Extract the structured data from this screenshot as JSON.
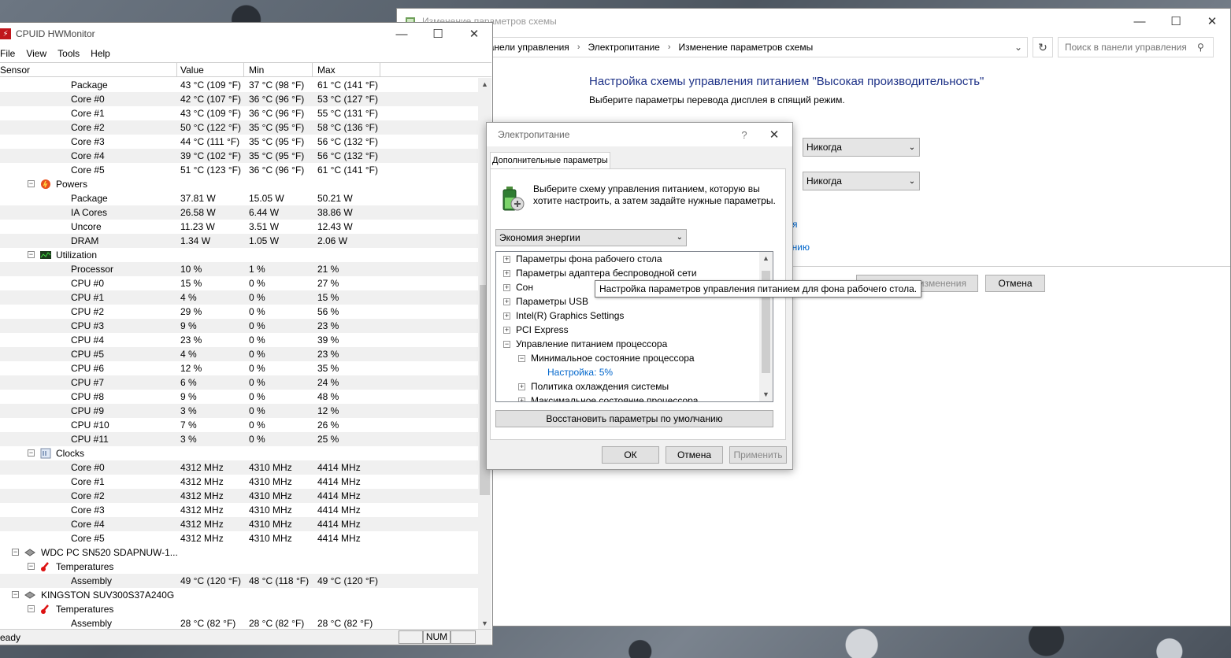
{
  "control_panel": {
    "title": "Изменение параметров схемы",
    "breadcrumb": [
      "Все элементы панели управления",
      "Электропитание",
      "Изменение параметров схемы"
    ],
    "search_placeholder": "Поиск в панели управления",
    "heading": "Настройка схемы управления питанием \"Высокая производительность\"",
    "subheading": "Выберите параметры перевода дисплея в спящий режим.",
    "select1": "Никогда",
    "select2": "Никогда",
    "link1_tail": "я",
    "link2_tail": "анию",
    "save_button_tail": "изменения",
    "cancel_button": "Отмена"
  },
  "hwmonitor": {
    "title": "CPUID HWMonitor",
    "menu": [
      "File",
      "View",
      "Tools",
      "Help"
    ],
    "columns": [
      "Sensor",
      "Value",
      "Min",
      "Max"
    ],
    "status": "eady",
    "num_indicator": "NUM",
    "rows": [
      {
        "level": 3,
        "name": "Package",
        "value": "43 °C  (109 °F)",
        "min": "37 °C  (98 °F)",
        "max": "61 °C  (141 °F)"
      },
      {
        "level": 3,
        "name": "Core #0",
        "value": "42 °C  (107 °F)",
        "min": "36 °C  (96 °F)",
        "max": "53 °C  (127 °F)"
      },
      {
        "level": 3,
        "name": "Core #1",
        "value": "43 °C  (109 °F)",
        "min": "36 °C  (96 °F)",
        "max": "55 °C  (131 °F)"
      },
      {
        "level": 3,
        "name": "Core #2",
        "value": "50 °C  (122 °F)",
        "min": "35 °C  (95 °F)",
        "max": "58 °C  (136 °F)"
      },
      {
        "level": 3,
        "name": "Core #3",
        "value": "44 °C  (111 °F)",
        "min": "35 °C  (95 °F)",
        "max": "56 °C  (132 °F)"
      },
      {
        "level": 3,
        "name": "Core #4",
        "value": "39 °C  (102 °F)",
        "min": "35 °C  (95 °F)",
        "max": "56 °C  (132 °F)"
      },
      {
        "level": 3,
        "name": "Core #5",
        "value": "51 °C  (123 °F)",
        "min": "36 °C  (96 °F)",
        "max": "61 °C  (141 °F)"
      },
      {
        "level": 2,
        "name": "Powers",
        "icon": "power-icon",
        "value": "",
        "min": "",
        "max": ""
      },
      {
        "level": 3,
        "name": "Package",
        "value": "37.81 W",
        "min": "15.05 W",
        "max": "50.21 W"
      },
      {
        "level": 3,
        "name": "IA Cores",
        "value": "26.58 W",
        "min": "6.44 W",
        "max": "38.86 W"
      },
      {
        "level": 3,
        "name": "Uncore",
        "value": "11.23 W",
        "min": "3.51 W",
        "max": "12.43 W"
      },
      {
        "level": 3,
        "name": "DRAM",
        "value": "1.34 W",
        "min": "1.05 W",
        "max": "2.06 W"
      },
      {
        "level": 2,
        "name": "Utilization",
        "icon": "utilization-icon",
        "value": "",
        "min": "",
        "max": ""
      },
      {
        "level": 3,
        "name": "Processor",
        "value": "10 %",
        "min": "1 %",
        "max": "21 %"
      },
      {
        "level": 3,
        "name": "CPU #0",
        "value": "15 %",
        "min": "0 %",
        "max": "27 %"
      },
      {
        "level": 3,
        "name": "CPU #1",
        "value": "4 %",
        "min": "0 %",
        "max": "15 %"
      },
      {
        "level": 3,
        "name": "CPU #2",
        "value": "29 %",
        "min": "0 %",
        "max": "56 %"
      },
      {
        "level": 3,
        "name": "CPU #3",
        "value": "9 %",
        "min": "0 %",
        "max": "23 %"
      },
      {
        "level": 3,
        "name": "CPU #4",
        "value": "23 %",
        "min": "0 %",
        "max": "39 %"
      },
      {
        "level": 3,
        "name": "CPU #5",
        "value": "4 %",
        "min": "0 %",
        "max": "23 %"
      },
      {
        "level": 3,
        "name": "CPU #6",
        "value": "12 %",
        "min": "0 %",
        "max": "35 %"
      },
      {
        "level": 3,
        "name": "CPU #7",
        "value": "6 %",
        "min": "0 %",
        "max": "24 %"
      },
      {
        "level": 3,
        "name": "CPU #8",
        "value": "9 %",
        "min": "0 %",
        "max": "48 %"
      },
      {
        "level": 3,
        "name": "CPU #9",
        "value": "3 %",
        "min": "0 %",
        "max": "12 %"
      },
      {
        "level": 3,
        "name": "CPU #10",
        "value": "7 %",
        "min": "0 %",
        "max": "26 %"
      },
      {
        "level": 3,
        "name": "CPU #11",
        "value": "3 %",
        "min": "0 %",
        "max": "25 %"
      },
      {
        "level": 2,
        "name": "Clocks",
        "icon": "clock-icon",
        "value": "",
        "min": "",
        "max": ""
      },
      {
        "level": 3,
        "name": "Core #0",
        "value": "4312 MHz",
        "min": "4310 MHz",
        "max": "4414 MHz"
      },
      {
        "level": 3,
        "name": "Core #1",
        "value": "4312 MHz",
        "min": "4310 MHz",
        "max": "4414 MHz"
      },
      {
        "level": 3,
        "name": "Core #2",
        "value": "4312 MHz",
        "min": "4310 MHz",
        "max": "4414 MHz"
      },
      {
        "level": 3,
        "name": "Core #3",
        "value": "4312 MHz",
        "min": "4310 MHz",
        "max": "4414 MHz"
      },
      {
        "level": 3,
        "name": "Core #4",
        "value": "4312 MHz",
        "min": "4310 MHz",
        "max": "4414 MHz"
      },
      {
        "level": 3,
        "name": "Core #5",
        "value": "4312 MHz",
        "min": "4310 MHz",
        "max": "4414 MHz"
      },
      {
        "level": 1,
        "name": "WDC PC SN520 SDAPNUW-1...",
        "icon": "drive-icon",
        "value": "",
        "min": "",
        "max": ""
      },
      {
        "level": 2,
        "name": "Temperatures",
        "icon": "thermometer-icon",
        "value": "",
        "min": "",
        "max": ""
      },
      {
        "level": 3,
        "name": "Assembly",
        "value": "49 °C  (120 °F)",
        "min": "48 °C  (118 °F)",
        "max": "49 °C  (120 °F)"
      },
      {
        "level": 1,
        "name": "KINGSTON SUV300S37A240G",
        "icon": "drive-icon",
        "value": "",
        "min": "",
        "max": ""
      },
      {
        "level": 2,
        "name": "Temperatures",
        "icon": "thermometer-icon",
        "value": "",
        "min": "",
        "max": ""
      },
      {
        "level": 3,
        "name": "Assembly",
        "value": "28 °C  (82 °F)",
        "min": "28 °C  (82 °F)",
        "max": "28 °C  (82 °F)"
      }
    ]
  },
  "power_dialog": {
    "title": "Электропитание",
    "help": "?",
    "tab": "Дополнительные параметры",
    "description": "Выберите схему управления питанием, которую вы хотите настроить, а затем задайте нужные параметры.",
    "scheme": "Экономия энергии",
    "tree": [
      {
        "indent": 0,
        "expander": "+",
        "label": "Параметры фона рабочего стола"
      },
      {
        "indent": 0,
        "expander": "+",
        "label": "Параметры адаптера беспроводной сети"
      },
      {
        "indent": 0,
        "expander": "+",
        "label": "Сон"
      },
      {
        "indent": 0,
        "expander": "+",
        "label": "Параметры USB"
      },
      {
        "indent": 0,
        "expander": "+",
        "label": "Intel(R) Graphics Settings"
      },
      {
        "indent": 0,
        "expander": "+",
        "label": "PCI Express"
      },
      {
        "indent": 0,
        "expander": "−",
        "label": "Управление питанием процессора"
      },
      {
        "indent": 1,
        "expander": "−",
        "label": "Минимальное состояние процессора"
      },
      {
        "indent": 2,
        "expander": "",
        "label": "Настройка: 5%",
        "link": true
      },
      {
        "indent": 1,
        "expander": "+",
        "label": "Политика охлаждения системы"
      },
      {
        "indent": 1,
        "expander": "+",
        "label": "Максимальное состояние процессора"
      }
    ],
    "restore_button": "Восстановить параметры по умолчанию",
    "ok_button": "ОК",
    "cancel_button": "Отмена",
    "apply_button": "Применить",
    "tooltip": "Настройка параметров управления питанием для фона рабочего стола."
  },
  "colors": {
    "heading_blue": "#1e3287",
    "link_blue": "#0066cc",
    "hw_logo_red": "#c0161c"
  }
}
